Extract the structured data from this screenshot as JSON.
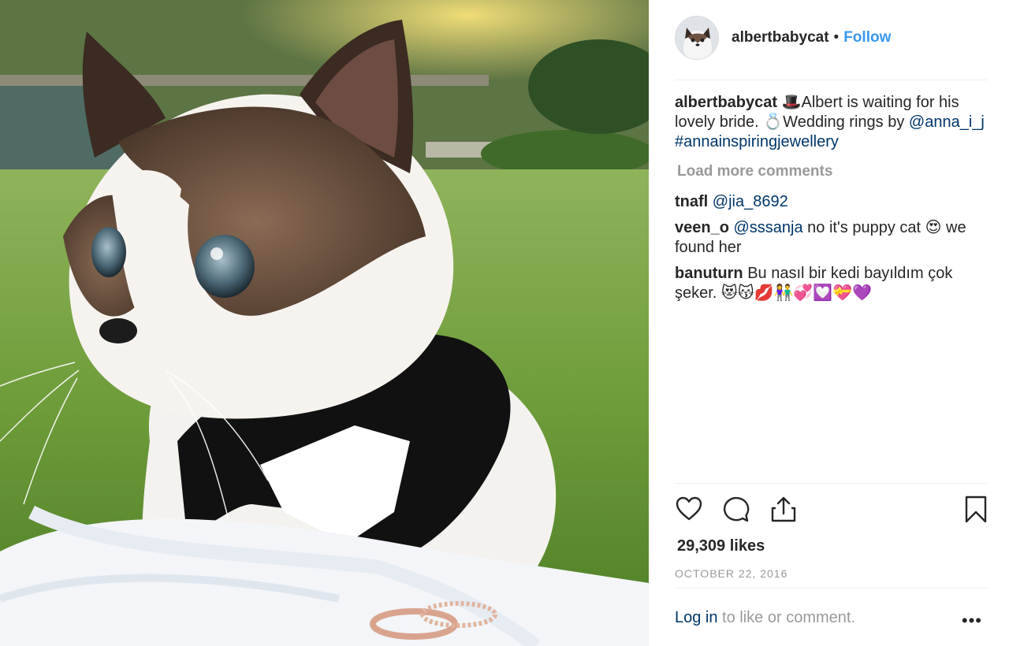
{
  "post": {
    "image_alt": "Cat in a tuxedo sitting on grass with wedding rings"
  },
  "header": {
    "username": "albertbabycat",
    "separator": "•",
    "follow_label": "Follow"
  },
  "caption": {
    "username": "albertbabycat",
    "text_1": " 🎩Albert is waiting for his lovely bride. 💍Wedding rings by ",
    "mention": "@anna_i_j",
    "hashtag": "#annainspiringjewellery"
  },
  "load_more_label": "Load more comments",
  "comments": [
    {
      "username": "tnafl",
      "mention": "@jia_8692",
      "text": ""
    },
    {
      "username": "veen_o",
      "mention": "@sssanja",
      "text": " no it's puppy cat 😍 we found her"
    },
    {
      "username": "banuturn",
      "mention": "",
      "text": " Bu nasıl bir kedi bayıldım çok şeker. 😻😽💋👫💞💟💝💜"
    }
  ],
  "actions": {
    "like_icon": "heart-icon",
    "comment_icon": "comment-icon",
    "share_icon": "share-icon",
    "save_icon": "bookmark-icon"
  },
  "likes_label": "29,309 likes",
  "date_label": "OCTOBER 22, 2016",
  "footer": {
    "login_label": "Log in",
    "rest_label": " to like or comment.",
    "more_label": "•••"
  }
}
